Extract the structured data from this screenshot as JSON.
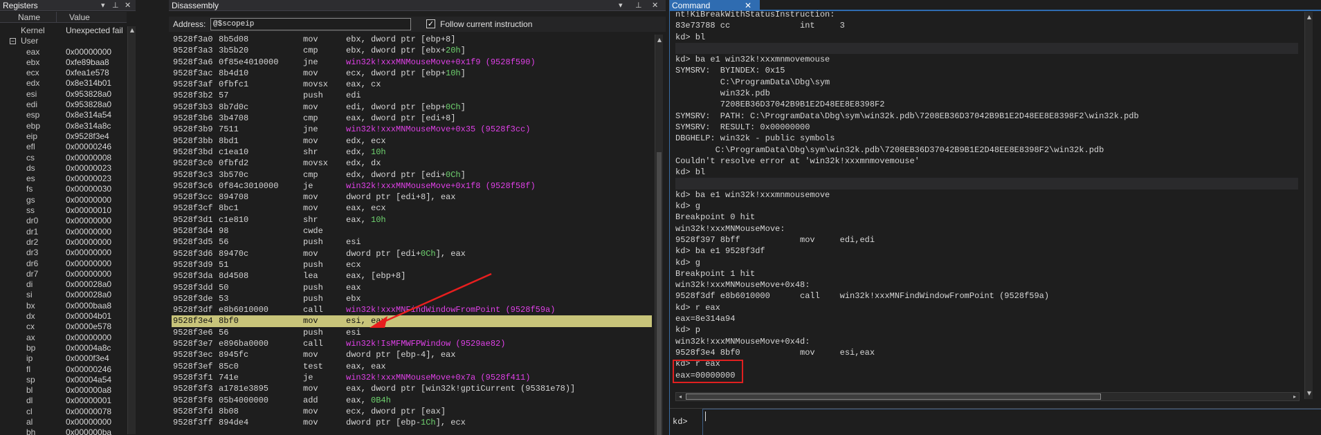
{
  "registers": {
    "title": "Registers",
    "col_name": "Name",
    "col_value": "Value",
    "rows": [
      {
        "name": "Kernel",
        "value": "Unexpected fail"
      },
      {
        "name": "User",
        "value": ""
      },
      {
        "name": "eax",
        "value": "0x00000000"
      },
      {
        "name": "ebx",
        "value": "0xfe89baa8"
      },
      {
        "name": "ecx",
        "value": "0xfea1e578"
      },
      {
        "name": "edx",
        "value": "0x8e314b01"
      },
      {
        "name": "esi",
        "value": "0x953828a0"
      },
      {
        "name": "edi",
        "value": "0x953828a0"
      },
      {
        "name": "esp",
        "value": "0x8e314a54"
      },
      {
        "name": "ebp",
        "value": "0x8e314a8c"
      },
      {
        "name": "eip",
        "value": "0x9528f3e4"
      },
      {
        "name": "efl",
        "value": "0x00000246"
      },
      {
        "name": "cs",
        "value": "0x00000008"
      },
      {
        "name": "ds",
        "value": "0x00000023"
      },
      {
        "name": "es",
        "value": "0x00000023"
      },
      {
        "name": "fs",
        "value": "0x00000030"
      },
      {
        "name": "gs",
        "value": "0x00000000"
      },
      {
        "name": "ss",
        "value": "0x00000010"
      },
      {
        "name": "dr0",
        "value": "0x00000000"
      },
      {
        "name": "dr1",
        "value": "0x00000000"
      },
      {
        "name": "dr2",
        "value": "0x00000000"
      },
      {
        "name": "dr3",
        "value": "0x00000000"
      },
      {
        "name": "dr6",
        "value": "0x00000000"
      },
      {
        "name": "dr7",
        "value": "0x00000000"
      },
      {
        "name": "di",
        "value": "0x000028a0"
      },
      {
        "name": "si",
        "value": "0x000028a0"
      },
      {
        "name": "bx",
        "value": "0x0000baa8"
      },
      {
        "name": "dx",
        "value": "0x00004b01"
      },
      {
        "name": "cx",
        "value": "0x0000e578"
      },
      {
        "name": "ax",
        "value": "0x00000000"
      },
      {
        "name": "bp",
        "value": "0x00004a8c"
      },
      {
        "name": "ip",
        "value": "0x0000f3e4"
      },
      {
        "name": "fl",
        "value": "0x00000246"
      },
      {
        "name": "sp",
        "value": "0x00004a54"
      },
      {
        "name": "bl",
        "value": "0x000000a8"
      },
      {
        "name": "dl",
        "value": "0x00000001"
      },
      {
        "name": "cl",
        "value": "0x00000078"
      },
      {
        "name": "al",
        "value": "0x00000000"
      },
      {
        "name": "bh",
        "value": "0x000000ba"
      }
    ]
  },
  "disassembly": {
    "title": "Disassembly",
    "address_label": "Address:",
    "address_value": "@$scopeip",
    "follow_label": "Follow current instruction",
    "follow_checked": true,
    "current_line_index": 25,
    "lines": [
      {
        "addr": "9528f3a0",
        "bytes": "8b5d08",
        "mnem": "mov",
        "ops": [
          {
            "t": "ebx, dword ptr [ebp+8]"
          }
        ]
      },
      {
        "addr": "9528f3a3",
        "bytes": "3b5b20",
        "mnem": "cmp",
        "ops": [
          {
            "t": "ebx, dword ptr [ebx+"
          },
          {
            "t": "20h",
            "c": "num"
          },
          {
            "t": "]"
          }
        ]
      },
      {
        "addr": "9528f3a6",
        "bytes": "0f85e4010000",
        "mnem": "jne",
        "ops": [
          {
            "t": "win32k!xxxMNMouseMove+0x1f9 (9528f590)",
            "c": "sym"
          }
        ]
      },
      {
        "addr": "9528f3ac",
        "bytes": "8b4d10",
        "mnem": "mov",
        "ops": [
          {
            "t": "ecx, dword ptr [ebp+"
          },
          {
            "t": "10h",
            "c": "num"
          },
          {
            "t": "]"
          }
        ]
      },
      {
        "addr": "9528f3af",
        "bytes": "0fbfc1",
        "mnem": "movsx",
        "ops": [
          {
            "t": "eax, cx"
          }
        ]
      },
      {
        "addr": "9528f3b2",
        "bytes": "57",
        "mnem": "push",
        "ops": [
          {
            "t": "edi"
          }
        ]
      },
      {
        "addr": "9528f3b3",
        "bytes": "8b7d0c",
        "mnem": "mov",
        "ops": [
          {
            "t": "edi, dword ptr [ebp+"
          },
          {
            "t": "0Ch",
            "c": "num"
          },
          {
            "t": "]"
          }
        ]
      },
      {
        "addr": "9528f3b6",
        "bytes": "3b4708",
        "mnem": "cmp",
        "ops": [
          {
            "t": "eax, dword ptr [edi+8]"
          }
        ]
      },
      {
        "addr": "9528f3b9",
        "bytes": "7511",
        "mnem": "jne",
        "ops": [
          {
            "t": "win32k!xxxMNMouseMove+0x35 (9528f3cc)",
            "c": "sym"
          }
        ]
      },
      {
        "addr": "9528f3bb",
        "bytes": "8bd1",
        "mnem": "mov",
        "ops": [
          {
            "t": "edx, ecx"
          }
        ]
      },
      {
        "addr": "9528f3bd",
        "bytes": "c1ea10",
        "mnem": "shr",
        "ops": [
          {
            "t": "edx, "
          },
          {
            "t": "10h",
            "c": "num"
          }
        ]
      },
      {
        "addr": "9528f3c0",
        "bytes": "0fbfd2",
        "mnem": "movsx",
        "ops": [
          {
            "t": "edx, dx"
          }
        ]
      },
      {
        "addr": "9528f3c3",
        "bytes": "3b570c",
        "mnem": "cmp",
        "ops": [
          {
            "t": "edx, dword ptr [edi+"
          },
          {
            "t": "0Ch",
            "c": "num"
          },
          {
            "t": "]"
          }
        ]
      },
      {
        "addr": "9528f3c6",
        "bytes": "0f84c3010000",
        "mnem": "je",
        "ops": [
          {
            "t": "win32k!xxxMNMouseMove+0x1f8 (9528f58f)",
            "c": "sym"
          }
        ]
      },
      {
        "addr": "9528f3cc",
        "bytes": "894708",
        "mnem": "mov",
        "ops": [
          {
            "t": "dword ptr [edi+8], eax"
          }
        ]
      },
      {
        "addr": "9528f3cf",
        "bytes": "8bc1",
        "mnem": "mov",
        "ops": [
          {
            "t": "eax, ecx"
          }
        ]
      },
      {
        "addr": "9528f3d1",
        "bytes": "c1e810",
        "mnem": "shr",
        "ops": [
          {
            "t": "eax, "
          },
          {
            "t": "10h",
            "c": "num"
          }
        ]
      },
      {
        "addr": "9528f3d4",
        "bytes": "98",
        "mnem": "cwde",
        "ops": []
      },
      {
        "addr": "9528f3d5",
        "bytes": "56",
        "mnem": "push",
        "ops": [
          {
            "t": "esi"
          }
        ]
      },
      {
        "addr": "9528f3d6",
        "bytes": "89470c",
        "mnem": "mov",
        "ops": [
          {
            "t": "dword ptr [edi+"
          },
          {
            "t": "0Ch",
            "c": "num"
          },
          {
            "t": "], eax"
          }
        ]
      },
      {
        "addr": "9528f3d9",
        "bytes": "51",
        "mnem": "push",
        "ops": [
          {
            "t": "ecx"
          }
        ]
      },
      {
        "addr": "9528f3da",
        "bytes": "8d4508",
        "mnem": "lea",
        "ops": [
          {
            "t": "eax, [ebp+8]"
          }
        ]
      },
      {
        "addr": "9528f3dd",
        "bytes": "50",
        "mnem": "push",
        "ops": [
          {
            "t": "eax"
          }
        ]
      },
      {
        "addr": "9528f3de",
        "bytes": "53",
        "mnem": "push",
        "ops": [
          {
            "t": "ebx"
          }
        ]
      },
      {
        "addr": "9528f3df",
        "bytes": "e8b6010000",
        "mnem": "call",
        "ops": [
          {
            "t": "win32k!xxxMNFindWindowFromPoint (9528f59a)",
            "c": "sym"
          }
        ]
      },
      {
        "addr": "9528f3e4",
        "bytes": "8bf0",
        "mnem": "mov",
        "ops": [
          {
            "t": "esi, eax"
          }
        ]
      },
      {
        "addr": "9528f3e6",
        "bytes": "56",
        "mnem": "push",
        "ops": [
          {
            "t": "esi"
          }
        ]
      },
      {
        "addr": "9528f3e7",
        "bytes": "e896ba0000",
        "mnem": "call",
        "ops": [
          {
            "t": "win32k!IsMFMWFPWindow (9529ae82)",
            "c": "sym"
          }
        ]
      },
      {
        "addr": "9528f3ec",
        "bytes": "8945fc",
        "mnem": "mov",
        "ops": [
          {
            "t": "dword ptr [ebp-4], eax"
          }
        ]
      },
      {
        "addr": "9528f3ef",
        "bytes": "85c0",
        "mnem": "test",
        "ops": [
          {
            "t": "eax, eax"
          }
        ]
      },
      {
        "addr": "9528f3f1",
        "bytes": "741e",
        "mnem": "je",
        "ops": [
          {
            "t": "win32k!xxxMNMouseMove+0x7a (9528f411)",
            "c": "sym"
          }
        ]
      },
      {
        "addr": "9528f3f3",
        "bytes": "a1781e3895",
        "mnem": "mov",
        "ops": [
          {
            "t": "eax, dword ptr [win32k!gptiCurrent (95381e78)]"
          }
        ]
      },
      {
        "addr": "9528f3f8",
        "bytes": "05b4000000",
        "mnem": "add",
        "ops": [
          {
            "t": "eax, "
          },
          {
            "t": "0B4h",
            "c": "num"
          }
        ]
      },
      {
        "addr": "9528f3fd",
        "bytes": "8b08",
        "mnem": "mov",
        "ops": [
          {
            "t": "ecx, dword ptr [eax]"
          }
        ]
      },
      {
        "addr": "9528f3ff",
        "bytes": "894de4",
        "mnem": "mov",
        "ops": [
          {
            "t": "dword ptr [ebp-"
          },
          {
            "t": "1Ch",
            "c": "num"
          },
          {
            "t": "], ecx"
          }
        ]
      }
    ]
  },
  "command": {
    "title": "Command",
    "prompt": "kd>",
    "input_value": "",
    "lines": [
      {
        "t": "nt!KiBreakWithStatusInstruction:"
      },
      {
        "t": "83e73788 cc              int     3"
      },
      {
        "t": "kd> bl"
      },
      {
        "t": "",
        "sep": true
      },
      {
        "t": "kd> ba e1 win32k!xxxmnmovemouse"
      },
      {
        "t": "SYMSRV:  BYINDEX: 0x15"
      },
      {
        "t": "         C:\\ProgramData\\Dbg\\sym"
      },
      {
        "t": "         win32k.pdb"
      },
      {
        "t": "         7208EB36D37042B9B1E2D48EE8E8398F2"
      },
      {
        "t": "SYMSRV:  PATH: C:\\ProgramData\\Dbg\\sym\\win32k.pdb\\7208EB36D37042B9B1E2D48EE8E8398F2\\win32k.pdb"
      },
      {
        "t": "SYMSRV:  RESULT: 0x00000000"
      },
      {
        "t": "DBGHELP: win32k - public symbols"
      },
      {
        "t": "        C:\\ProgramData\\Dbg\\sym\\win32k.pdb\\7208EB36D37042B9B1E2D48EE8E8398F2\\win32k.pdb"
      },
      {
        "t": "Couldn't resolve error at 'win32k!xxxmnmovemouse'"
      },
      {
        "t": "kd> bl"
      },
      {
        "t": "",
        "sep": true
      },
      {
        "t": "kd> ba e1 win32k!xxxmnmousemove"
      },
      {
        "t": "kd> g"
      },
      {
        "t": "Breakpoint 0 hit"
      },
      {
        "t": "win32k!xxxMNMouseMove:"
      },
      {
        "t": "9528f397 8bff            mov     edi,edi"
      },
      {
        "t": "kd> ba e1 9528f3df"
      },
      {
        "t": "kd> g"
      },
      {
        "t": "Breakpoint 1 hit"
      },
      {
        "t": "win32k!xxxMNMouseMove+0x48:"
      },
      {
        "t": "9528f3df e8b6010000      call    win32k!xxxMNFindWindowFromPoint (9528f59a)"
      },
      {
        "t": "kd> r eax"
      },
      {
        "t": "eax=8e314a94"
      },
      {
        "t": "kd> p"
      },
      {
        "t": "win32k!xxxMNMouseMove+0x4d:"
      },
      {
        "t": "9528f3e4 8bf0            mov     esi,eax"
      },
      {
        "t": "kd> r eax"
      },
      {
        "t": "eax=00000000"
      }
    ]
  }
}
